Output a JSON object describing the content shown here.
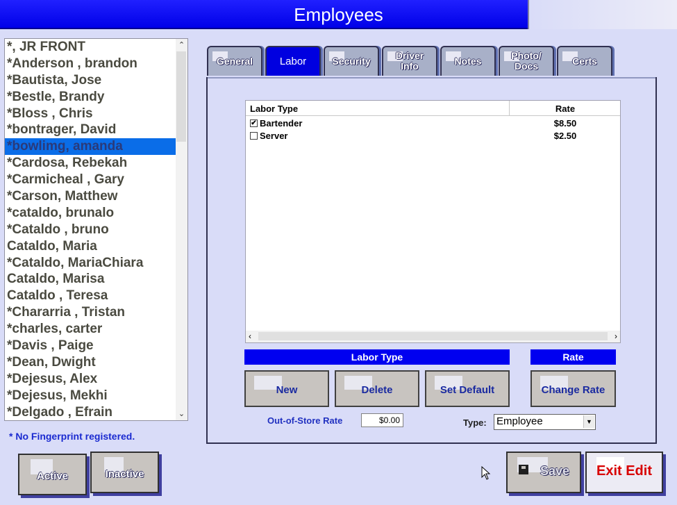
{
  "window": {
    "title": "Employees"
  },
  "employees": [
    "*, JR FRONT",
    "*Anderson , brandon",
    "*Bautista, Jose",
    "*Bestle, Brandy",
    "*Bloss , Chris",
    "*bontrager, David",
    "*bowlimg, amanda",
    "*Cardosa, Rebekah",
    "*Carmicheal , Gary",
    "*Carson, Matthew",
    "*cataldo, brunalo",
    "*Cataldo , bruno",
    "Cataldo, Maria",
    "*Cataldo, MariaChiara",
    "Cataldo, Marisa",
    "Cataldo , Teresa",
    "*Chararria , Tristan",
    "*charles, carter",
    "*Davis , Paige",
    "*Dean, Dwight",
    "*Dejesus, Alex",
    "*Dejesus, Mekhi",
    "*Delgado , Efrain"
  ],
  "selected_employee": "*bowlimg, amanda",
  "footnote": "* No Fingerprint registered.",
  "filter_buttons": {
    "active": "Active",
    "inactive": "Inactive"
  },
  "tabs": [
    {
      "label": "General",
      "active": false
    },
    {
      "label": "Labor",
      "active": true
    },
    {
      "label": "Security",
      "active": false
    },
    {
      "label": "Driver\nInfo",
      "active": false
    },
    {
      "label": "Notes",
      "active": false
    },
    {
      "label": "Photo/\nDocs",
      "active": false
    },
    {
      "label": "Certs",
      "active": false
    }
  ],
  "labor_table": {
    "columns": [
      "Labor Type",
      "Rate"
    ],
    "rows": [
      {
        "checked": true,
        "type": "Bartender",
        "rate": "$8.50"
      },
      {
        "checked": false,
        "type": "Server",
        "rate": "$2.50"
      }
    ]
  },
  "labor_type_header": "Labor Type",
  "rate_header": "Rate",
  "labor_buttons": {
    "new": "New",
    "delete": "Delete",
    "set_default": "Set Default",
    "change_rate": "Change Rate"
  },
  "out_of_store": {
    "label": "Out-of-Store Rate",
    "value": "$0.00"
  },
  "type_select": {
    "label": "Type:",
    "value": "Employee"
  },
  "bottom_buttons": {
    "save": "Save",
    "exit_edit": "Exit Edit"
  },
  "colors": {
    "title_bar": "#0000e8",
    "selection": "#0a6de8",
    "exit_text": "#d80000"
  }
}
